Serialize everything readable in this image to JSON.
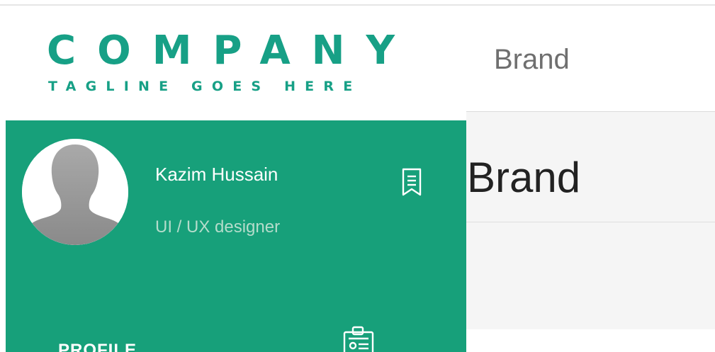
{
  "logo": {
    "name": "COMPANY",
    "tagline": "TAGLINE GOES HERE",
    "color": "#17a086"
  },
  "nav": {
    "brand_link": "Brand"
  },
  "content": {
    "heading": "Brand"
  },
  "sidebar": {
    "background": "#17a07a",
    "user": {
      "name": "Kazim Hussain",
      "role": "UI / UX designer",
      "avatar_icon": "user-silhouette-icon"
    },
    "bookmark_icon": "bookmark-icon",
    "items": [
      {
        "label": "PROFILE",
        "icon": "id-card-icon"
      }
    ]
  }
}
